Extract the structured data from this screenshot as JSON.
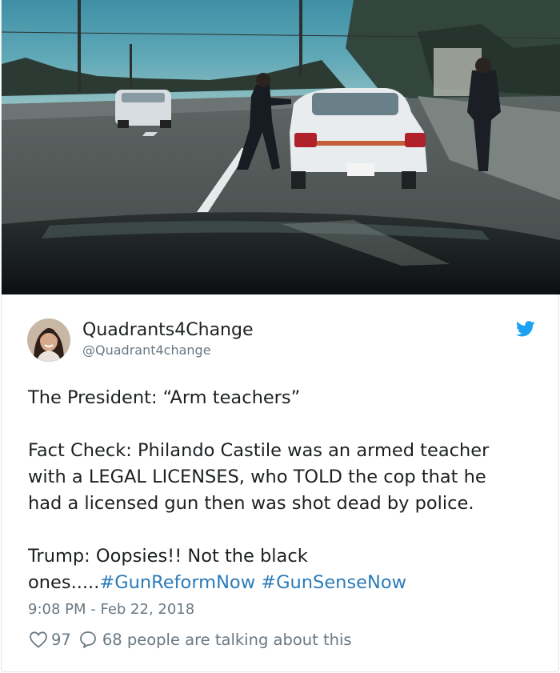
{
  "tweet": {
    "display_name": "Quadrants4Change",
    "handle": "@Quadrant4change",
    "text_line_1": "The President: “Arm teachers”",
    "text_line_2": "Fact Check: Philando Castile was an armed teacher",
    "text_line_3": "with a LEGAL LICENSES, who TOLD the cop that he",
    "text_line_4": "had a licensed gun then was shot dead by police.",
    "text_line_5": "Trump: Oopsies!! Not the black",
    "text_line_6_prefix": "ones.....",
    "hashtag_1": "#GunReformNow",
    "hashtag_2": "#GunSenseNow",
    "timestamp": "9:08 PM - Feb 22, 2018",
    "like_count": "97",
    "talking_text": "68 people are talking about this"
  },
  "colors": {
    "link": "#2b7bb9",
    "muted": "#697882",
    "twitter_blue": "#1da1f2",
    "text": "#1c2022"
  },
  "icons": {
    "brand": "twitter-bird-icon",
    "like": "heart-icon",
    "reply": "speech-bubble-icon"
  }
}
